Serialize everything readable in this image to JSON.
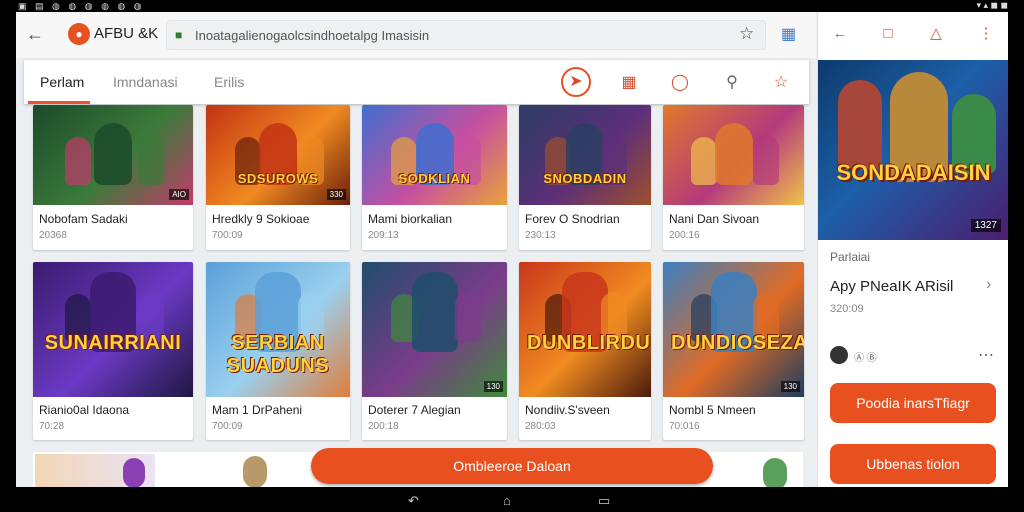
{
  "status": {
    "left": "▣ ▤ ◍ ◍ ◍ ◍ ◍ ◍",
    "right": "▾ ▴ ◼ ◼"
  },
  "browser": {
    "site_name": "AFBU &K",
    "url": "Inoatagalienogaolcsindhoetalpg Imasisin",
    "back_icon": "back-arrow-icon",
    "star_icon": "bookmark-star-icon",
    "menu_icon": "grid-menu-icon"
  },
  "tabs": [
    {
      "label": "Perlam",
      "active": true
    },
    {
      "label": "Imndanasi",
      "active": false
    },
    {
      "label": "Erilis",
      "active": false
    }
  ],
  "toolbar_icons": [
    "brand-logo-icon",
    "grid-icon",
    "shield-icon",
    "search-icon",
    "star-icon"
  ],
  "cards": [
    {
      "title": "Nobofam Sadaki",
      "meta": "20368",
      "badge": "AIO",
      "logo": "",
      "colors": [
        "#1c4a2a",
        "#3b7b3a",
        "#c23b6b"
      ]
    },
    {
      "title": "Hredkly 9 Sokioae",
      "meta": "700:09",
      "badge": "330",
      "logo": "SDSUROWS",
      "colors": [
        "#c23214",
        "#f08a21",
        "#6a1f0c"
      ]
    },
    {
      "title": "Mami biorkalian",
      "meta": "209:13",
      "badge": "",
      "logo": "SODKLIAN",
      "colors": [
        "#3f6fcf",
        "#c64fa1",
        "#e8a33a"
      ]
    },
    {
      "title": "Forev O Snodrian",
      "meta": "230:13",
      "badge": "",
      "logo": "SNOBDADIN",
      "colors": [
        "#2b3e63",
        "#5c2f7a",
        "#9e4f2a"
      ]
    },
    {
      "title": "Nani Dan Sivoan",
      "meta": "200:16",
      "badge": "",
      "logo": "",
      "colors": [
        "#e1792a",
        "#b43a7c",
        "#f2c24a"
      ]
    },
    {
      "title": "Rianio0al Idaona",
      "meta": "70:28",
      "badge": "",
      "logo": "SUNAIRRIANI",
      "colors": [
        "#3b1b6e",
        "#6a3ac4",
        "#1e1740"
      ]
    },
    {
      "title": "Mam 1 DrPaheni",
      "meta": "700:09",
      "badge": "",
      "logo": "SERBIAN SUADUNS",
      "colors": [
        "#5aa0d8",
        "#9ad0ef",
        "#e07c3a"
      ]
    },
    {
      "title": "Doterer 7 Alegian",
      "meta": "200:18",
      "badge": "130",
      "logo": "",
      "colors": [
        "#1f4d6b",
        "#7a3c8a",
        "#3f8a3a"
      ]
    },
    {
      "title": "Nondiiv.S'sveen",
      "meta": "280:03",
      "badge": "",
      "logo": "DUNBLIRDUN",
      "colors": [
        "#c8361b",
        "#f08c21",
        "#4a1a0c"
      ]
    },
    {
      "title": "Nombl 5 Nmeen",
      "meta": "70:016",
      "badge": "130",
      "logo": "DUNDIOSEZA",
      "colors": [
        "#3a7fc0",
        "#e06b25",
        "#1e3d5f"
      ]
    }
  ],
  "fab_label": "Ombleeroe Daloan",
  "side": {
    "hero_logo": "SONDADAISIN",
    "hero_badge": "1327",
    "section": "Parlaiai",
    "title": "Apy PNeaIK ARisil",
    "meta": "320:09",
    "share_text": "Ⓐ Ⓑ",
    "button_primary": "Poodia inarsTfiagr",
    "button_secondary": "Ubbenas tiolon"
  }
}
